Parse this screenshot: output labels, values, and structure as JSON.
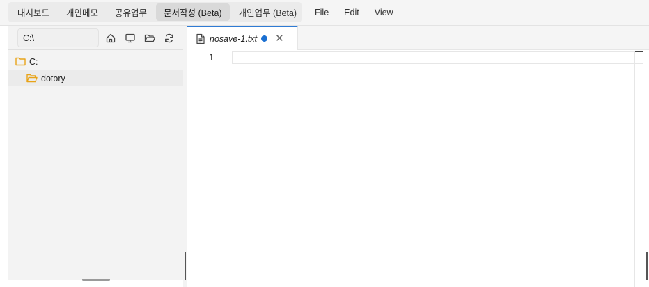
{
  "top_nav": {
    "tabs": [
      {
        "label": "대시보드"
      },
      {
        "label": "개인메모"
      },
      {
        "label": "공유업무"
      },
      {
        "label": "문서작성 (Beta)",
        "active": true
      },
      {
        "label": "개인업무 (Beta)"
      }
    ]
  },
  "menu": {
    "items": [
      {
        "label": "File"
      },
      {
        "label": "Edit"
      },
      {
        "label": "View"
      }
    ]
  },
  "explorer": {
    "path_value": "C:\\",
    "toolbar_icons": [
      "home-icon",
      "desktop-icon",
      "folder-open-icon",
      "refresh-icon"
    ],
    "tree": {
      "root": {
        "label": "C:",
        "icon": "folder-icon"
      },
      "children": [
        {
          "label": "dotory",
          "icon": "folder-open-icon"
        }
      ]
    }
  },
  "editor": {
    "tab": {
      "filename": "nosave-1.txt",
      "icon": "file-text-icon",
      "unsaved": true
    },
    "lines": [
      {
        "number": "1",
        "text": ""
      }
    ]
  },
  "colors": {
    "accent": "#2f7bd4",
    "unsaved_dot": "#1a6fd1",
    "folder": "#e8a317"
  }
}
